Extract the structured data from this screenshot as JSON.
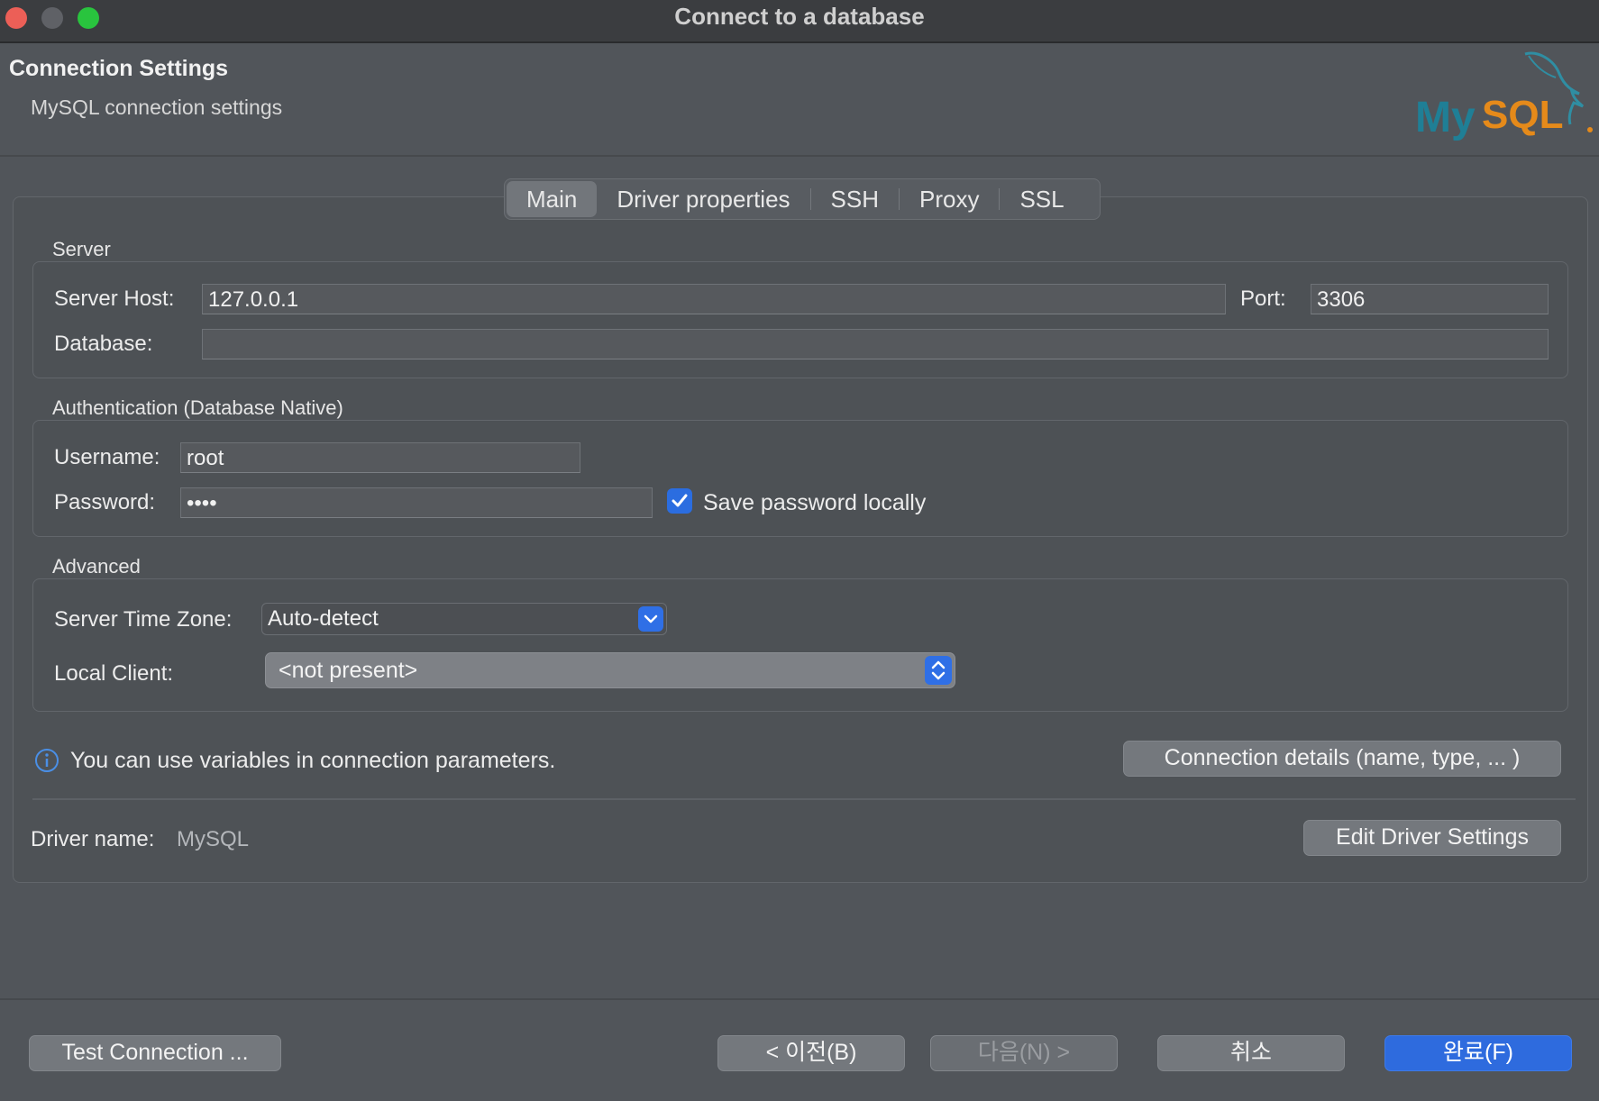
{
  "window": {
    "title": "Connect to a database"
  },
  "header": {
    "title": "Connection Settings",
    "subtitle": "MySQL connection settings",
    "logo_text": "MySQL"
  },
  "tabs": [
    {
      "label": "Main",
      "active": true
    },
    {
      "label": "Driver properties"
    },
    {
      "label": "SSH"
    },
    {
      "label": "Proxy"
    },
    {
      "label": "SSL"
    }
  ],
  "server": {
    "section_label": "Server",
    "host_label": "Server Host:",
    "host_value": "127.0.0.1",
    "port_label": "Port:",
    "port_value": "3306",
    "database_label": "Database:",
    "database_value": ""
  },
  "auth": {
    "section_label": "Authentication (Database Native)",
    "username_label": "Username:",
    "username_value": "root",
    "password_label": "Password:",
    "password_value": "••••",
    "save_password_label": "Save password locally",
    "save_password_checked": true
  },
  "advanced": {
    "section_label": "Advanced",
    "timezone_label": "Server Time Zone:",
    "timezone_value": "Auto-detect",
    "local_client_label": "Local Client:",
    "local_client_value": "<not present>"
  },
  "info": {
    "variables_text": "You can use variables in connection parameters.",
    "connection_details_button": "Connection details (name, type, ... )"
  },
  "driver": {
    "label": "Driver name:",
    "value": "MySQL",
    "edit_button": "Edit Driver Settings"
  },
  "footer": {
    "test_button": "Test Connection ...",
    "back_button": "< 이전(B)",
    "next_button": "다음(N) >",
    "cancel_button": "취소",
    "finish_button": "완료(F)"
  },
  "colors": {
    "accent": "#2e6bde",
    "mysql_blue": "#00758f",
    "mysql_orange": "#f29111"
  }
}
